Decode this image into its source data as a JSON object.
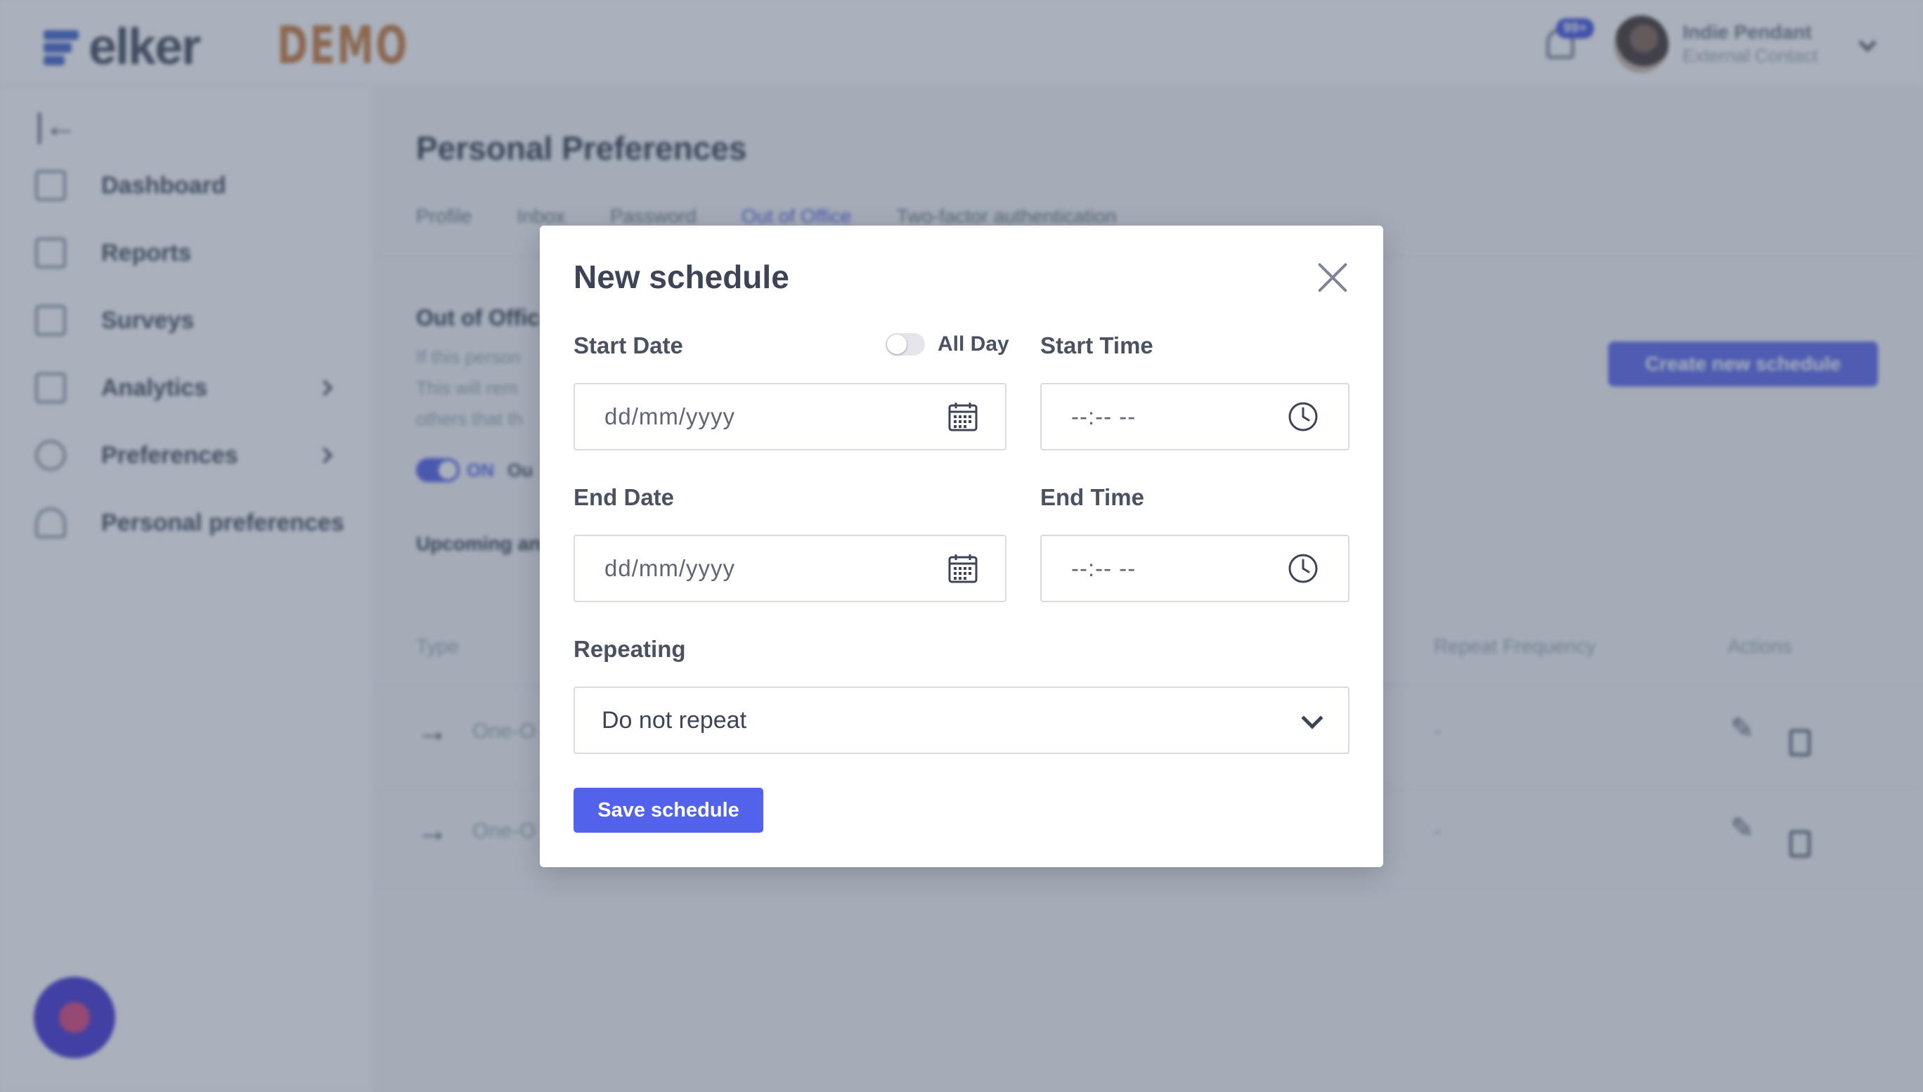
{
  "header": {
    "logo_text": "elker",
    "demo_label": "DEMO",
    "notification_count": "99+",
    "user_name": "Indie Pendant",
    "user_role": "External Contact"
  },
  "sidebar": {
    "items": [
      {
        "label": "Dashboard",
        "icon": "grid-icon"
      },
      {
        "label": "Reports",
        "icon": "reports-icon"
      },
      {
        "label": "Surveys",
        "icon": "surveys-icon"
      },
      {
        "label": "Analytics",
        "icon": "chart-icon"
      },
      {
        "label": "Preferences",
        "icon": "gear-icon"
      },
      {
        "label": "Personal preferences",
        "icon": "user-icon"
      }
    ]
  },
  "main": {
    "page_title": "Personal Preferences",
    "tabs": [
      "Profile",
      "Inbox",
      "Password",
      "Out of Office",
      "Two-factor authentication"
    ],
    "section_title": "Out of Offic",
    "section_desc": [
      "If this person",
      "This will rem",
      "others that th"
    ],
    "toggle_label": "ON",
    "toggle_extra": "Ou",
    "upcoming_title": "Upcoming an",
    "create_button": "Create new schedule",
    "table": {
      "headers": [
        "Type",
        "Repeat Frequency",
        "Actions"
      ],
      "rows": [
        {
          "type": "One-O",
          "repeat": "-"
        },
        {
          "type": "One-O",
          "repeat": "-"
        }
      ]
    }
  },
  "modal": {
    "title": "New schedule",
    "start_date_label": "Start Date",
    "all_day_label": "All Day",
    "all_day_on": false,
    "start_time_label": "Start Time",
    "start_date_placeholder": "dd/mm/yyyy",
    "start_time_placeholder": "--:-- --",
    "end_date_label": "End Date",
    "end_time_label": "End Time",
    "end_date_placeholder": "dd/mm/yyyy",
    "end_time_placeholder": "--:-- --",
    "repeating_label": "Repeating",
    "repeating_value": "Do not repeat",
    "save_button": "Save schedule"
  },
  "colors": {
    "accent": "#5362ea",
    "overlay": "#46546e"
  }
}
